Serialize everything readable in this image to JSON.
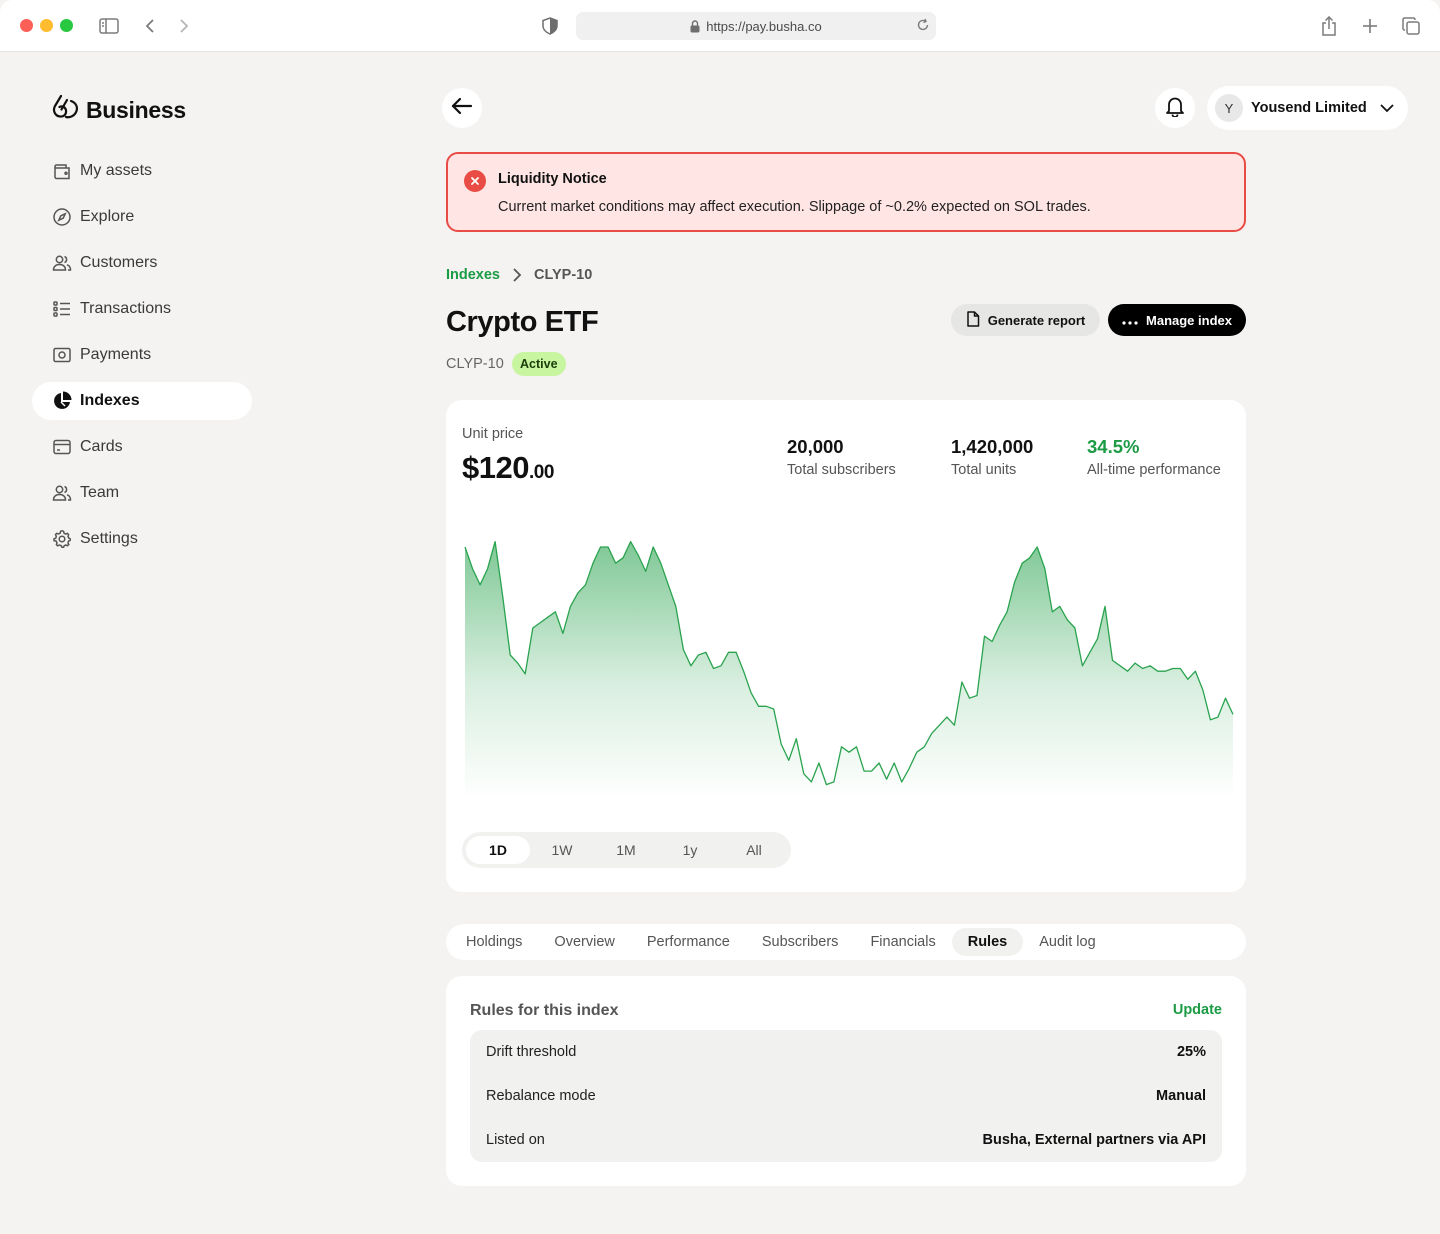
{
  "browser": {
    "url": "https://pay.busha.co"
  },
  "sidebar": {
    "brand": "Business",
    "items": [
      {
        "label": "My assets",
        "icon": "wallet-icon"
      },
      {
        "label": "Explore",
        "icon": "compass-icon"
      },
      {
        "label": "Customers",
        "icon": "users-icon"
      },
      {
        "label": "Transactions",
        "icon": "list-icon"
      },
      {
        "label": "Payments",
        "icon": "cash-icon"
      },
      {
        "label": "Indexes",
        "icon": "pie-chart-icon",
        "active": true
      },
      {
        "label": "Cards",
        "icon": "card-icon"
      },
      {
        "label": "Team",
        "icon": "team-icon"
      },
      {
        "label": "Settings",
        "icon": "gear-icon"
      }
    ]
  },
  "header": {
    "account_initial": "Y",
    "account_name": "Yousend Limited"
  },
  "notice": {
    "title": "Liquidity Notice",
    "body": "Current market conditions may affect execution. Slippage of ~0.2% expected on SOL trades."
  },
  "breadcrumb": {
    "parent": "Indexes",
    "current": "CLYP-10"
  },
  "index": {
    "title": "Crypto ETF",
    "ticker": "CLYP-10",
    "status": "Active",
    "generate_report_label": "Generate report",
    "manage_label": "Manage index"
  },
  "price_card": {
    "unit_label": "Unit price",
    "price_main": "$120",
    "price_cents": ".00",
    "stats": [
      {
        "value": "20,000",
        "label": "Total subscribers",
        "positive": false
      },
      {
        "value": "1,420,000",
        "label": "Total units",
        "positive": false
      },
      {
        "value": "34.5%",
        "label": "All-time performance",
        "positive": true
      }
    ],
    "ranges": [
      "1D",
      "1W",
      "1M",
      "1y",
      "All"
    ],
    "active_range": "1D"
  },
  "chart_data": {
    "type": "area",
    "title": "",
    "xlabel": "",
    "ylabel": "",
    "ylim": [
      0,
      100
    ],
    "grid": false,
    "legend": "none",
    "color": "#2aa34f",
    "series": [
      {
        "values": [
          90,
          82,
          76,
          82,
          92,
          72,
          50,
          47,
          43,
          60,
          62,
          64,
          66,
          58,
          68,
          73,
          76,
          84,
          90,
          90,
          84,
          86,
          92,
          87,
          81,
          90,
          84,
          76,
          68,
          52,
          46,
          50,
          51,
          45,
          46,
          51,
          51,
          44,
          36,
          31,
          31,
          30,
          17,
          11,
          19,
          6,
          3,
          10,
          2,
          3,
          16,
          14,
          16,
          7,
          7,
          10,
          4,
          10,
          3,
          8,
          14,
          16,
          21,
          24,
          27,
          24,
          40,
          34,
          35,
          57,
          55,
          61,
          66,
          77,
          84,
          86,
          90,
          82,
          66,
          68,
          63,
          60,
          46,
          51,
          56,
          68,
          48,
          46,
          44,
          47,
          45,
          46,
          44,
          44,
          45,
          45,
          41,
          44,
          37,
          26,
          27,
          34,
          28
        ]
      }
    ]
  },
  "tabs": {
    "items": [
      "Holdings",
      "Overview",
      "Performance",
      "Subscribers",
      "Financials",
      "Rules",
      "Audit log"
    ],
    "active": "Rules"
  },
  "rules": {
    "title": "Rules for this index",
    "update_label": "Update",
    "rows": [
      {
        "label": "Drift threshold",
        "value": "25%"
      },
      {
        "label": "Rebalance mode",
        "value": "Manual"
      },
      {
        "label": "Listed on",
        "value": "Busha, External partners via API"
      }
    ]
  }
}
